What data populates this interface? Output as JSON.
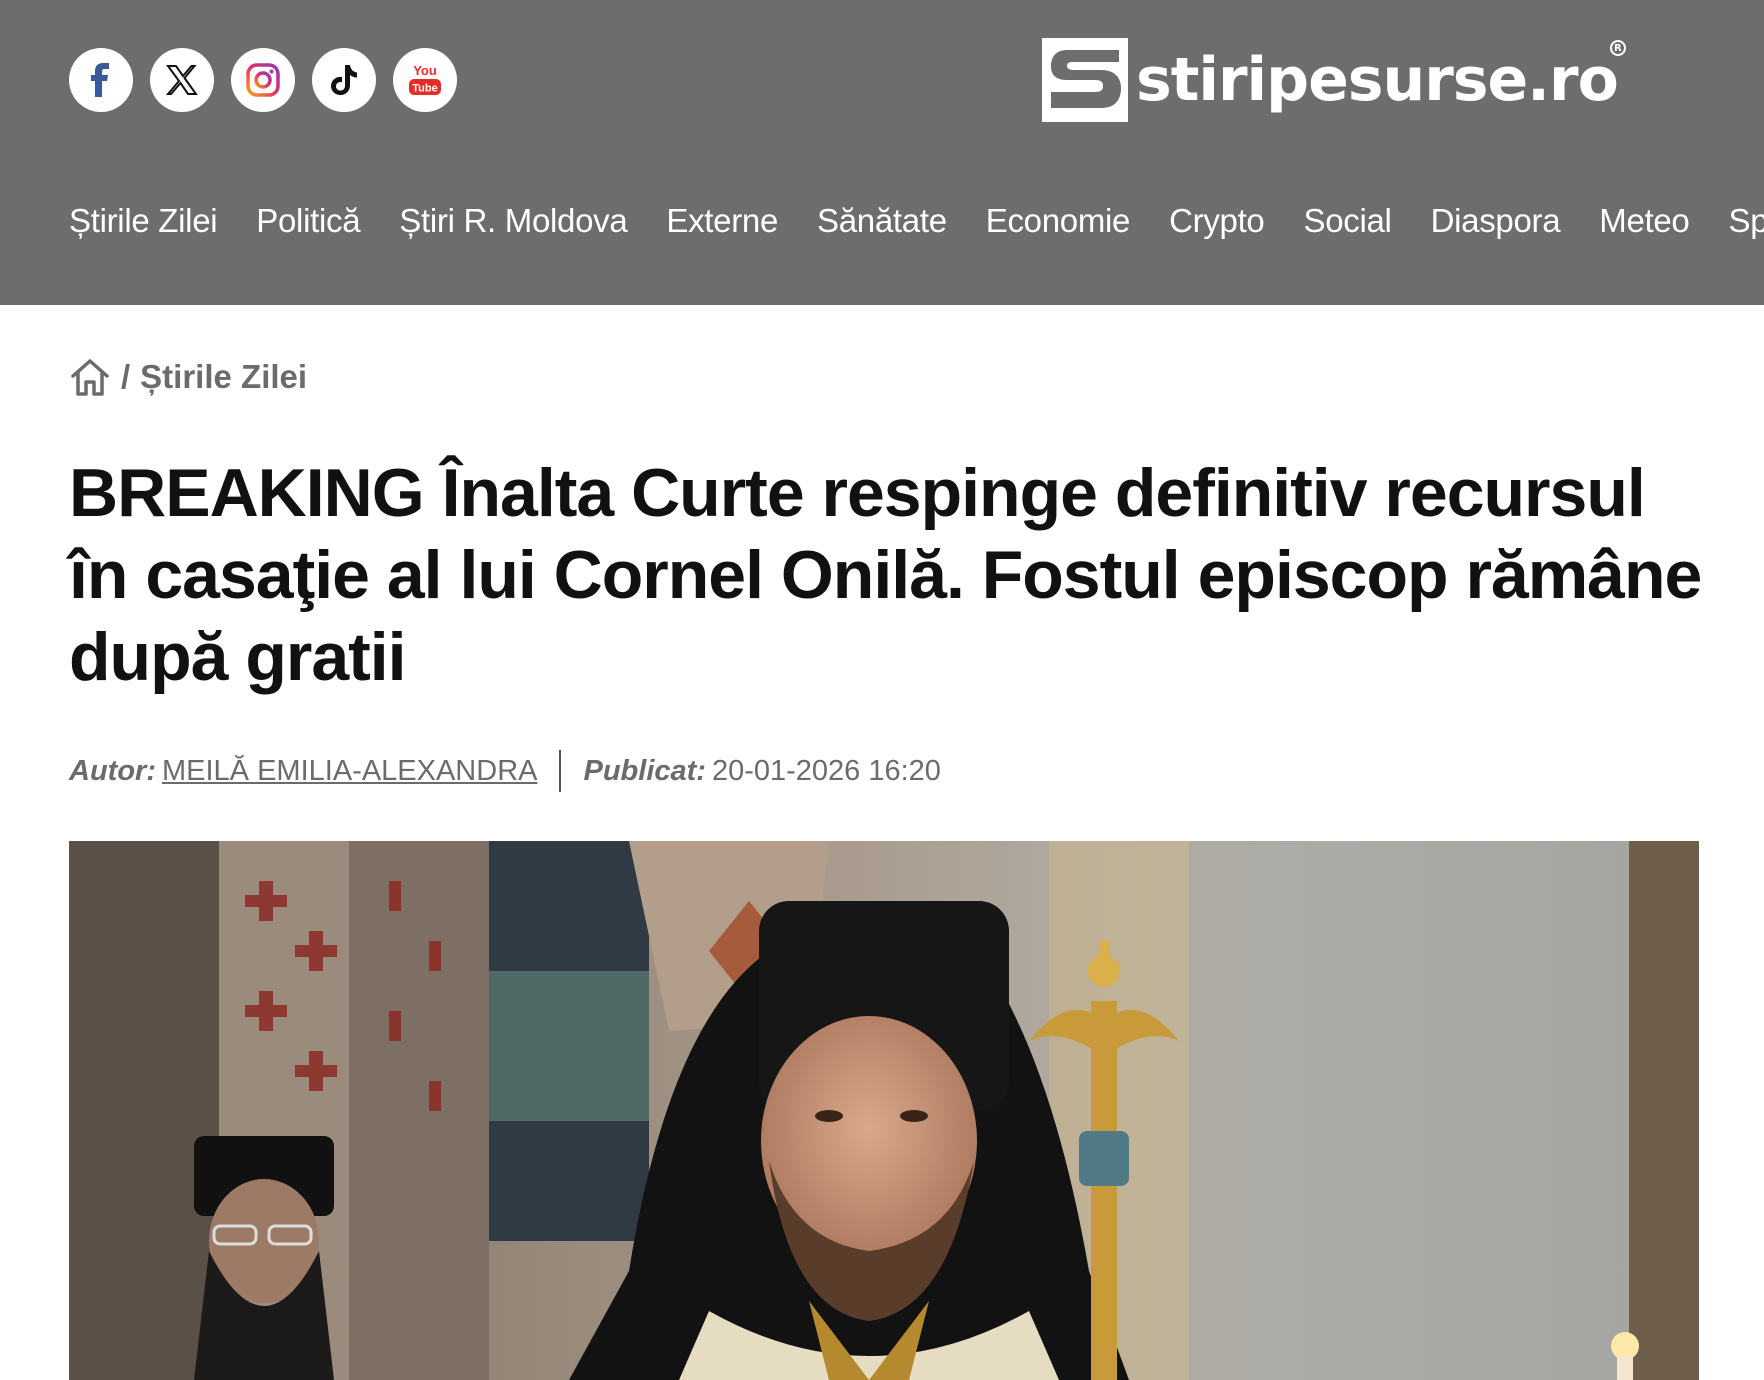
{
  "header": {
    "social": [
      {
        "name": "facebook-icon",
        "label": "f"
      },
      {
        "name": "x-icon",
        "label": "𝕏"
      },
      {
        "name": "instagram-icon",
        "label": ""
      },
      {
        "name": "tiktok-icon",
        "label": "♪"
      },
      {
        "name": "youtube-icon",
        "label": "You Tube"
      }
    ],
    "logo_text": "stiripesurse.ro",
    "logo_mark": "S",
    "logo_reg": "R",
    "nav": [
      "Știrile Zilei",
      "Politică",
      "Știri R. Moldova",
      "Externe",
      "Sănătate",
      "Economie",
      "Crypto",
      "Social",
      "Diaspora",
      "Meteo",
      "Spo"
    ]
  },
  "breadcrumb": {
    "separator": "/",
    "current": "Știrile Zilei"
  },
  "article": {
    "title": "BREAKING Înalta Curte respinge definitiv recursul în casaţie al lui Cornel Onilă. Fostul episcop rămâne după gratii",
    "author_label": "Autor:",
    "author": "MEILĂ EMILIA-ALEXANDRA",
    "published_label": "Publicat:",
    "published": "20-01-2026 16:20"
  },
  "colors": {
    "header_bg": "#6d6d6d",
    "text_dark": "#111111",
    "text_muted": "#6b6b6b"
  }
}
